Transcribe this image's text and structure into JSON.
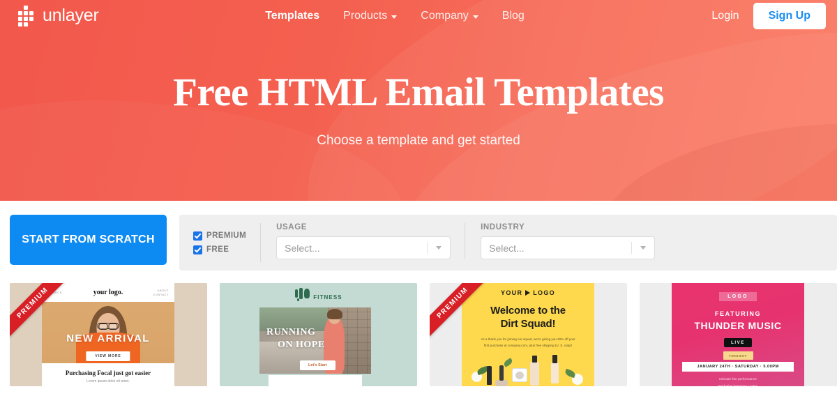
{
  "brand": {
    "name": "unlayer",
    "logo_icon": "grid-squares-icon"
  },
  "nav": {
    "links": [
      {
        "label": "Templates",
        "active": true,
        "caret": false
      },
      {
        "label": "Products",
        "active": false,
        "caret": true
      },
      {
        "label": "Company",
        "active": false,
        "caret": true
      },
      {
        "label": "Blog",
        "active": false,
        "caret": false
      }
    ],
    "login_label": "Login",
    "signup_label": "Sign Up",
    "signup_text_color": "#1a8cf0"
  },
  "hero": {
    "title": "Free HTML Email Templates",
    "subtitle": "Choose a template and get started",
    "background_color": "#f4604f"
  },
  "filters": {
    "scratch_button": "START FROM SCRATCH",
    "scratch_button_color": "#0d8bf2",
    "checkboxes": [
      {
        "label": "PREMIUM",
        "checked": true
      },
      {
        "label": "FREE",
        "checked": true
      }
    ],
    "checkbox_color": "#1a73e8",
    "groups": [
      {
        "label": "USAGE",
        "value": "Select...",
        "placeholder": "Select..."
      },
      {
        "label": "INDUSTRY",
        "value": "Select...",
        "placeholder": "Select..."
      }
    ]
  },
  "templates": {
    "ribbon_label": "PREMIUM",
    "ribbon_color": "#d81f26",
    "cards": [
      {
        "id": "new-arrival",
        "premium": true,
        "nav_left": "SERVICE",
        "logo": "your logo.",
        "nav_right_1": "ABOUT",
        "nav_right_2": "CONTACT",
        "headline": "NEW ARRIVAL",
        "button": "VIEW MORE",
        "footer_heading": "Purchasing Focal just got easier",
        "footer_text": "Lorem ipsum dolor sit amet."
      },
      {
        "id": "fitness",
        "premium": false,
        "logo_word": "FITNESS",
        "title_line1": "RUNNING",
        "title_line2": "ON HOPE",
        "button": "Let's Start"
      },
      {
        "id": "dirt-squad",
        "premium": true,
        "logo_prefix": "YOUR",
        "logo_suffix": "LOGO",
        "headline_line1": "Welcome to the",
        "headline_line2": "Dirt Squad!",
        "body": "As a thank you for joining our squad, we're giving you 20% off your first purchase at company.com, plus free shipping (U. S. only)!"
      },
      {
        "id": "thunder-music",
        "premium": false,
        "logo": "LOGO",
        "featuring": "FEATURING",
        "band": "THUNDER MUSIC",
        "live_badge": "LIVE",
        "tonight_badge": "TONIGHT",
        "date": "JANUARY 24TH · SATURDAY · 5.00PM",
        "bullets": "Intimate live performance\nExclusive interview + Q&A\nThunder series jazzmaster giveaway"
      }
    ]
  }
}
